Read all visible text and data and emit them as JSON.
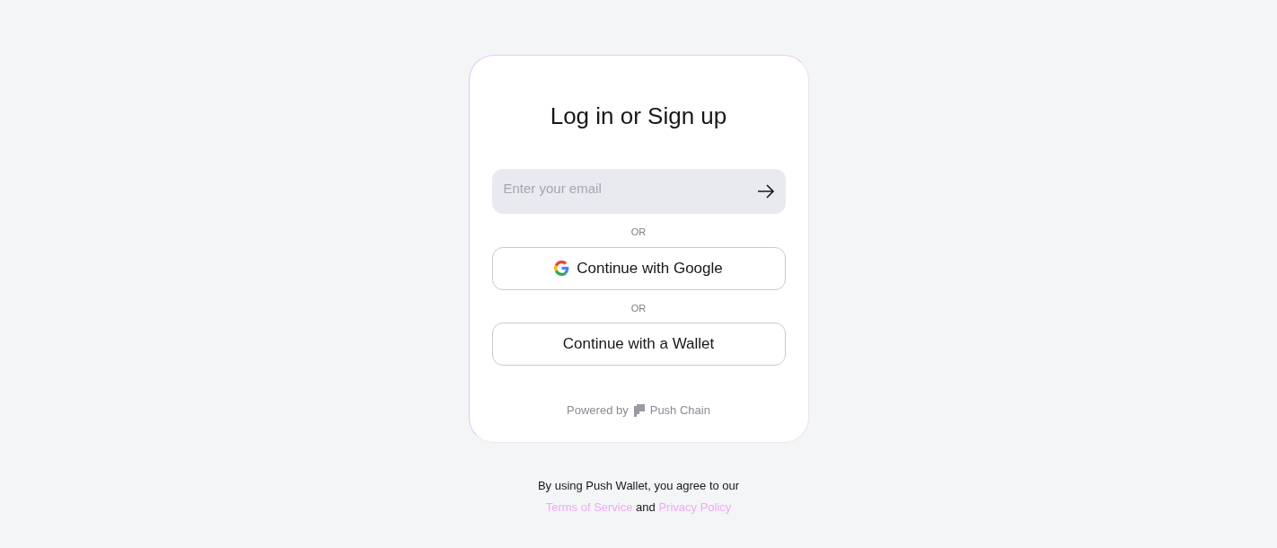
{
  "card": {
    "title": "Log in or Sign up",
    "email_field": {
      "placeholder": "Enter your email"
    },
    "separators": [
      "OR",
      "OR"
    ],
    "buttons": [
      {
        "kind": "google",
        "label": "Continue with Google"
      },
      {
        "kind": "plain",
        "label": "Continue with a Wallet"
      }
    ],
    "footer": {
      "prefix": "Powered by",
      "brand": "Push Chain"
    }
  },
  "legal": {
    "prefix": "By using Push Wallet, you agree to our ",
    "terms_link": "Terms of Service",
    "middle": " and ",
    "privacy_link": "Privacy Policy"
  }
}
